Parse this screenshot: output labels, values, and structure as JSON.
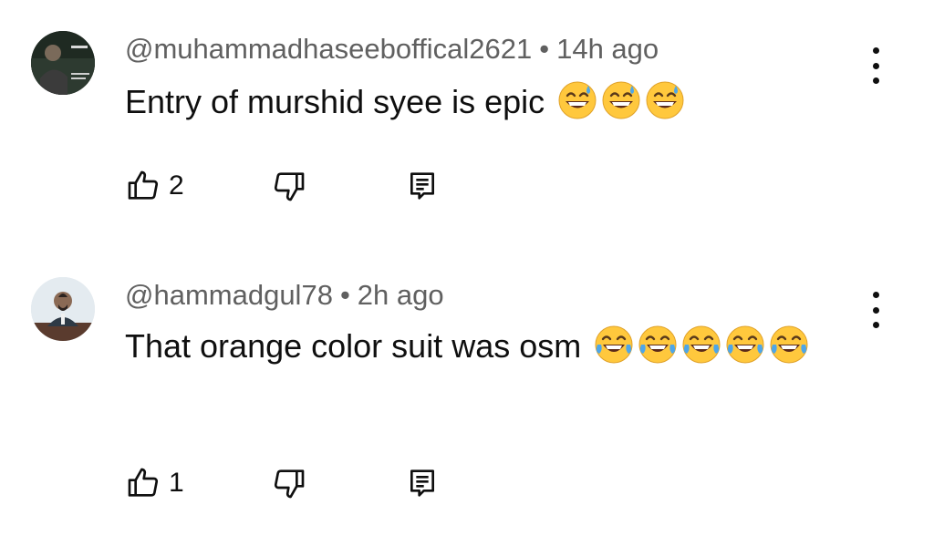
{
  "comments": [
    {
      "username": "@muhammadhaseeboffical2621",
      "separator": "•",
      "time": "14h ago",
      "text": "Entry of murshid syee is epic",
      "emoji": "grinning-sweat-emoji",
      "emoji_count": 3,
      "like_count": "2"
    },
    {
      "username": "@hammadgul78",
      "separator": "•",
      "time": "2h ago",
      "text": "That orange color suit was osm",
      "emoji": "tears-of-joy-emoji",
      "emoji_count": 5,
      "like_count": "1"
    }
  ],
  "colors": {
    "meta_text": "#606060",
    "primary_text": "#0f0f0f",
    "emoji_face": "#FFC83D",
    "emoji_tear": "#4EA6E8"
  }
}
